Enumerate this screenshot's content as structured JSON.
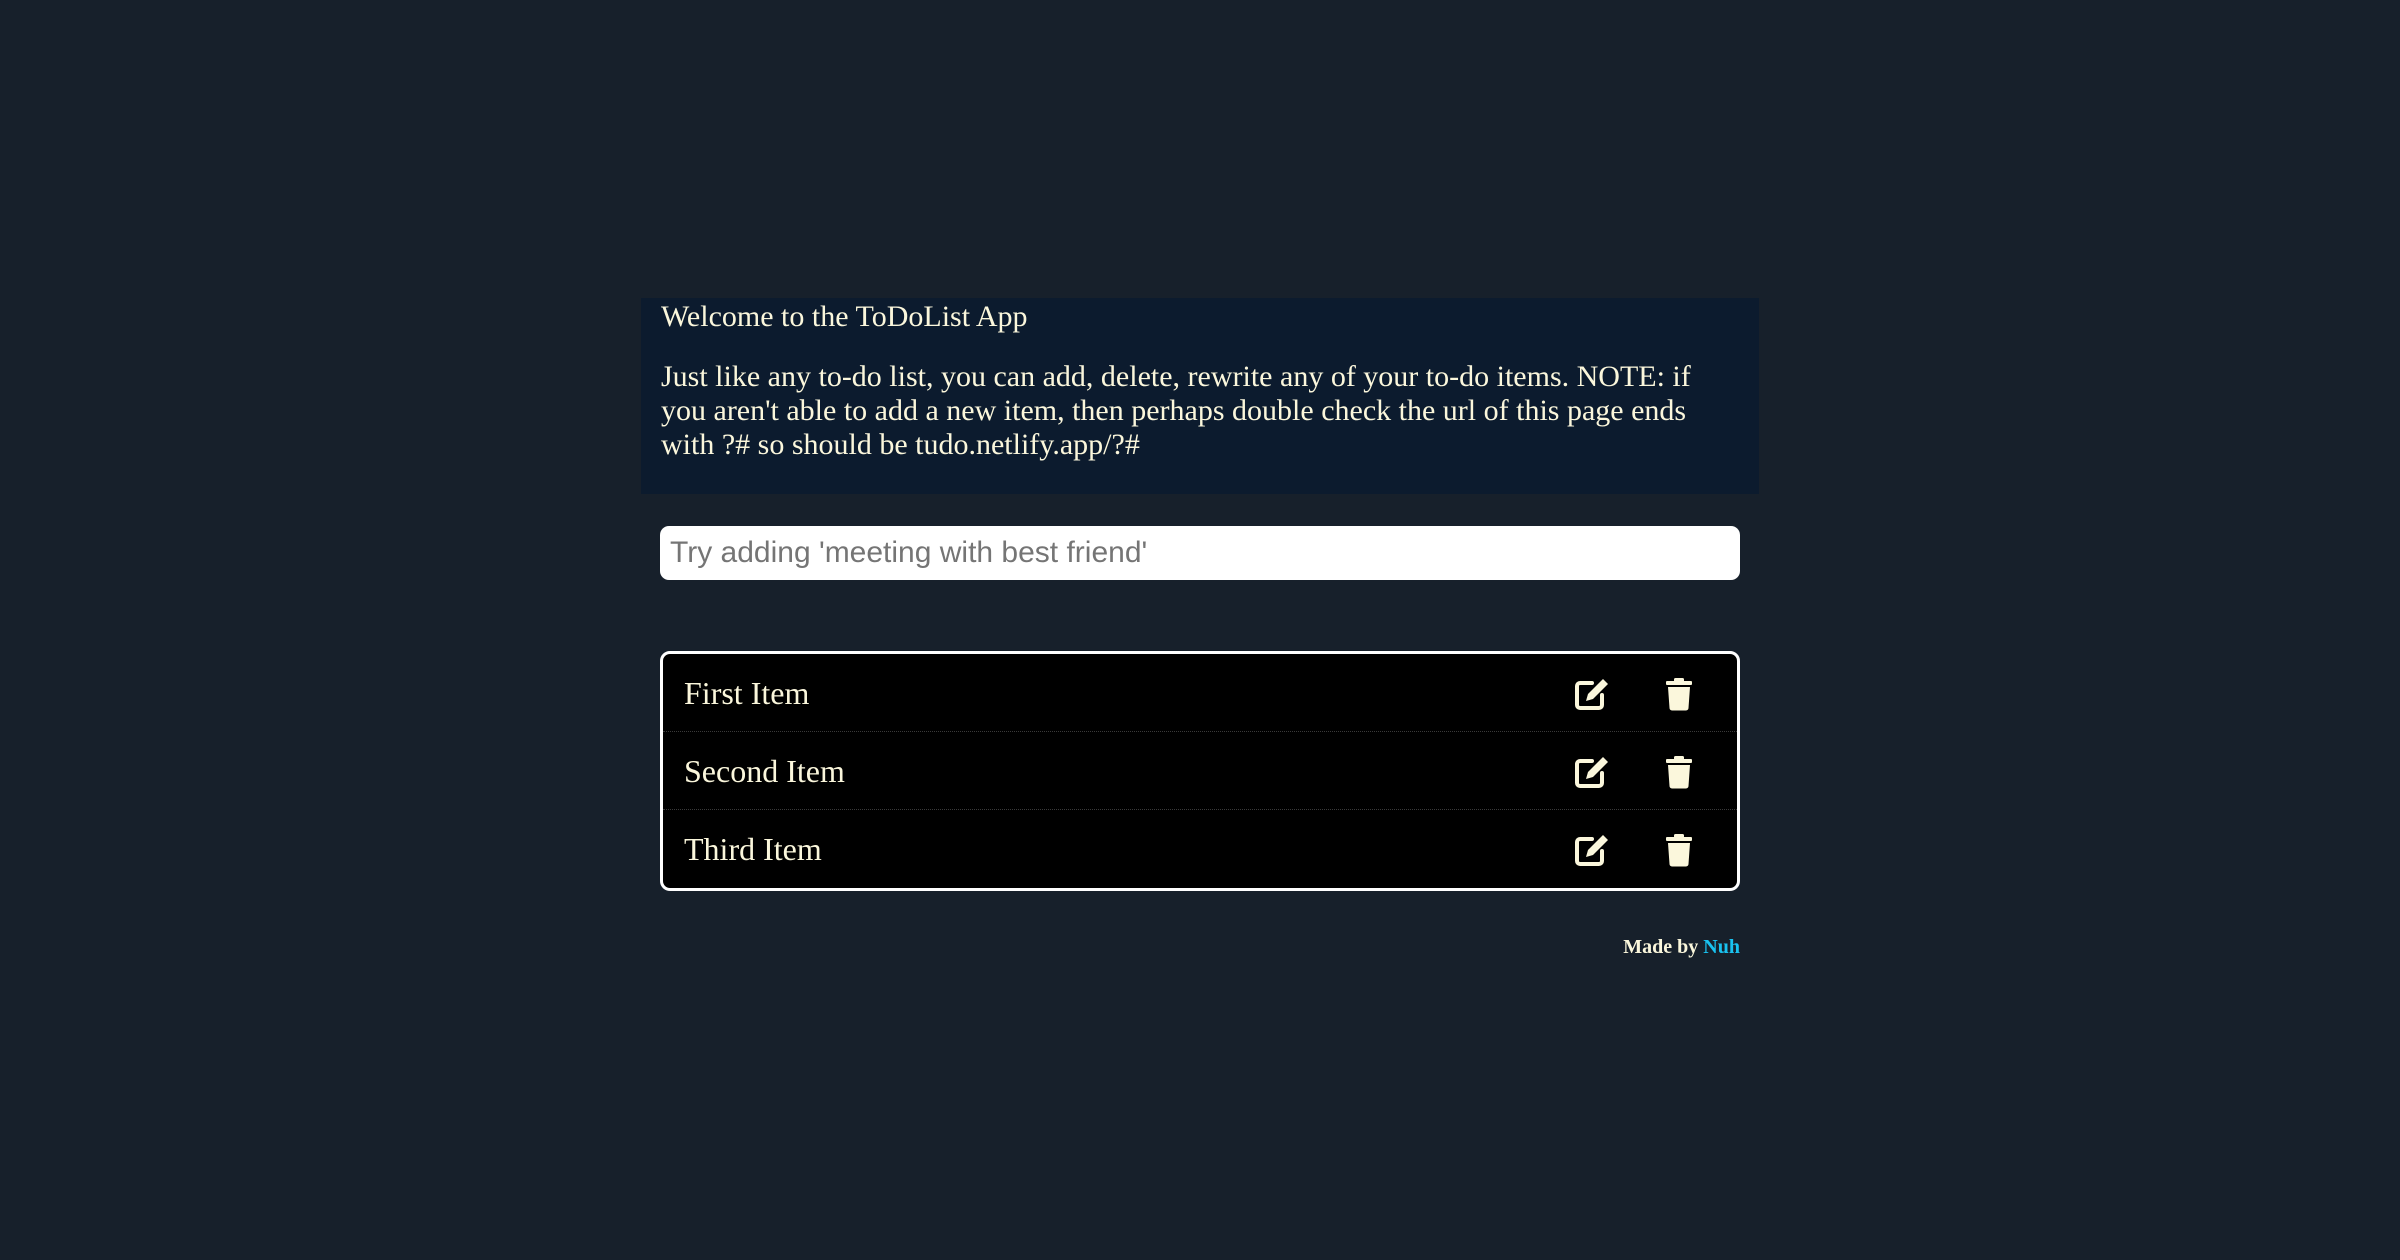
{
  "intro": {
    "title": "Welcome to the ToDoList App",
    "description": "Just like any to-do list, you can add, delete, rewrite any of your to-do items. NOTE: if you aren't able to add a new item, then perhaps double check the url of this page ends with ?# so should be tudo.netlify.app/?#"
  },
  "add_input": {
    "placeholder": "Try adding 'meeting with best friend'",
    "value": ""
  },
  "todos": [
    {
      "label": "First Item",
      "edit_icon": "edit-icon",
      "delete_icon": "trash-icon"
    },
    {
      "label": "Second Item",
      "edit_icon": "edit-icon",
      "delete_icon": "trash-icon"
    },
    {
      "label": "Third Item",
      "edit_icon": "edit-icon",
      "delete_icon": "trash-icon"
    }
  ],
  "footer": {
    "prefix": "Made by",
    "author": "Nuh"
  },
  "colors": {
    "background": "#17202b",
    "intro_panel": "#0c1b2e",
    "text": "#fbf7dc",
    "list_background": "#000000",
    "list_border": "#ffffff",
    "accent_link": "#19c2f0"
  }
}
